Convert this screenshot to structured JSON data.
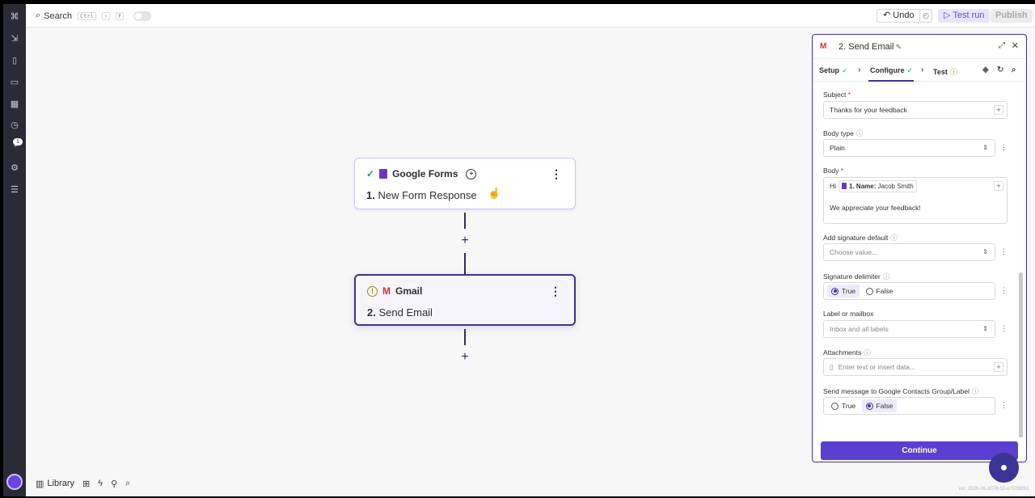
{
  "topbar": {
    "search_label": "Search",
    "shortcut_keys": [
      "Ctrl",
      "⇧",
      "F"
    ],
    "undo_label": "Undo",
    "test_run_label": "Test run",
    "publish_label": "Publish"
  },
  "rail": {
    "notification_count": "1"
  },
  "nodes": [
    {
      "app": "Google Forms",
      "step": "1.",
      "title": "New Form Response",
      "status": "complete"
    },
    {
      "app": "Gmail",
      "step": "2.",
      "title": "Send Email",
      "status": "warning"
    }
  ],
  "bottom_toolbar": {
    "library_label": "Library"
  },
  "version": "ver. 2026-06-30T6-52-e7026853",
  "panel": {
    "title": "2. Send Email",
    "tabs": [
      {
        "label": "Setup",
        "state": "done"
      },
      {
        "label": "Configure",
        "state": "done"
      },
      {
        "label": "Test",
        "state": "warning"
      }
    ],
    "fields": {
      "subject_label": "Subject",
      "subject_value": "Thanks for your feedback",
      "body_type_label": "Body type",
      "body_type_value": "Plain",
      "body_label": "Body",
      "body_prefix": "Hi",
      "body_pill_key": "1. Name:",
      "body_pill_value": "Jacob Smith",
      "body_line2": "We appreciate your feedback!",
      "signature_default_label": "Add signature default",
      "signature_default_placeholder": "Choose value...",
      "signature_delimiter_label": "Signature delimiter",
      "signature_delimiter_selected": "True",
      "label_mailbox_label": "Label or mailbox",
      "label_mailbox_value": "Inbox and all labels",
      "attachments_label": "Attachments",
      "attachments_placeholder": "Enter text or insert data...",
      "contacts_group_label": "Send message to Google Contacts Group/Label",
      "contacts_group_selected": "False"
    },
    "radio_true": "True",
    "radio_false": "False",
    "continue_label": "Continue"
  }
}
